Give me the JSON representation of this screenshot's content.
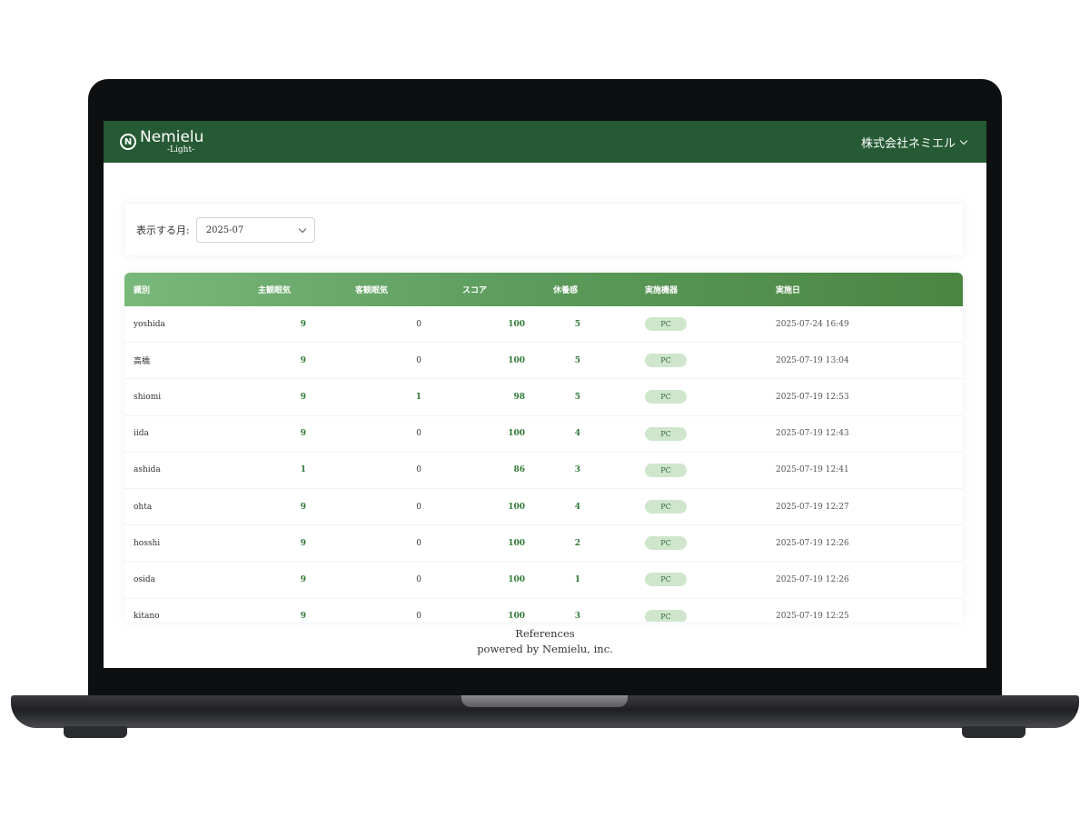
{
  "header": {
    "brand_mark": "N",
    "brand_name": "Nemielu",
    "brand_sub": "-Light-",
    "company": "株式会社ネミエル"
  },
  "filter": {
    "label": "表示する月:",
    "value": "2025-07"
  },
  "table": {
    "columns": [
      "識別",
      "主観眠気",
      "客観眠気",
      "スコア",
      "休養感",
      "実施機器",
      "実施日"
    ],
    "rows": [
      {
        "name": "yoshida",
        "subj": "9",
        "obj": "0",
        "score": "100",
        "rest": "5",
        "device": "PC",
        "date": "2025-07-24 16:49"
      },
      {
        "name": "高橋",
        "subj": "9",
        "obj": "0",
        "score": "100",
        "rest": "5",
        "device": "PC",
        "date": "2025-07-19 13:04"
      },
      {
        "name": "shiomi",
        "subj": "9",
        "obj": "1",
        "score": "98",
        "rest": "5",
        "device": "PC",
        "date": "2025-07-19 12:53"
      },
      {
        "name": "iida",
        "subj": "9",
        "obj": "0",
        "score": "100",
        "rest": "4",
        "device": "PC",
        "date": "2025-07-19 12:43"
      },
      {
        "name": "ashida",
        "subj": "1",
        "obj": "0",
        "score": "86",
        "rest": "3",
        "device": "PC",
        "date": "2025-07-19 12:41"
      },
      {
        "name": "ohta",
        "subj": "9",
        "obj": "0",
        "score": "100",
        "rest": "4",
        "device": "PC",
        "date": "2025-07-19 12:27"
      },
      {
        "name": "hosshi",
        "subj": "9",
        "obj": "0",
        "score": "100",
        "rest": "2",
        "device": "PC",
        "date": "2025-07-19 12:26"
      },
      {
        "name": "osida",
        "subj": "9",
        "obj": "0",
        "score": "100",
        "rest": "1",
        "device": "PC",
        "date": "2025-07-19 12:26"
      },
      {
        "name": "kitano",
        "subj": "9",
        "obj": "0",
        "score": "100",
        "rest": "3",
        "device": "PC",
        "date": "2025-07-19 12:25"
      }
    ]
  },
  "footer": {
    "line1": "References",
    "line2": "powered by Nemielu, inc."
  },
  "colors": {
    "header_bg": "#255a34",
    "accent_green": "#2f7a36",
    "badge_bg": "#cfe6cd"
  }
}
